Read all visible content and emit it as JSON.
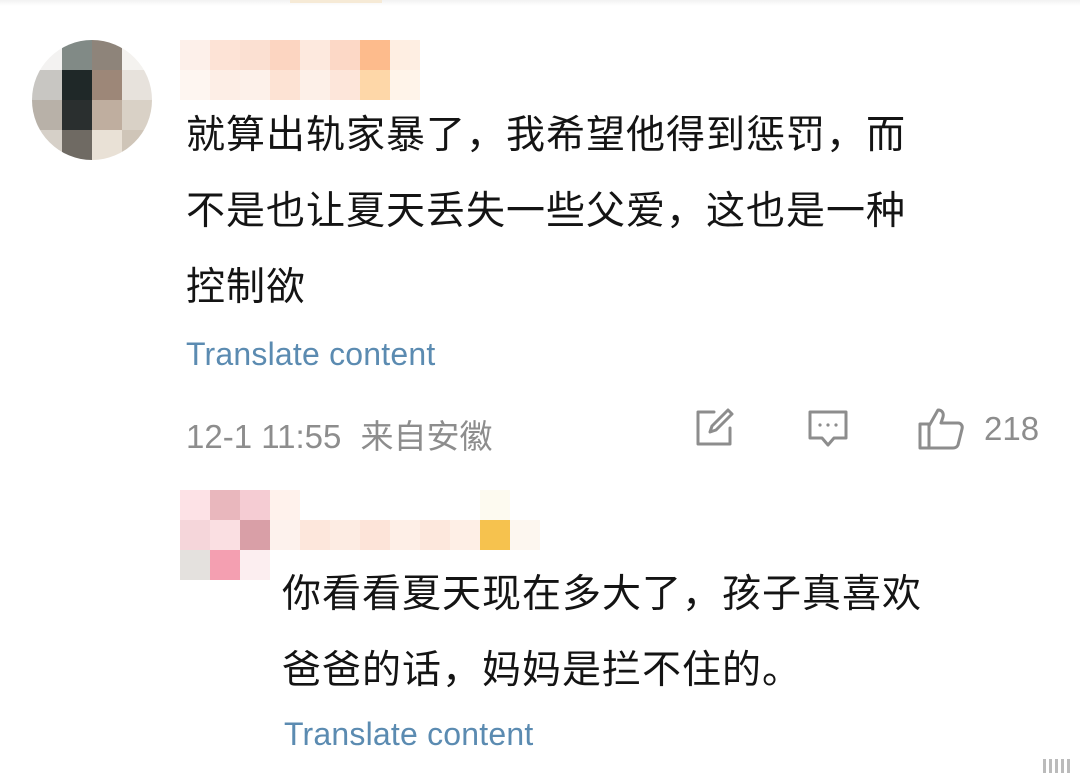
{
  "comment": {
    "text_lines": [
      "就算出轨家暴了，我希望他得到惩罚，而",
      "不是也让夏天丢失一些父爱，这也是一种",
      "控制欲"
    ],
    "translate_label": "Translate content",
    "timestamp": "12-1 11:55",
    "location": "来自安徽",
    "like_count": "218",
    "icons": {
      "edit": "edit-icon",
      "reply": "comment-icon",
      "like": "thumbs-up-icon"
    }
  },
  "reply": {
    "text_lines": [
      "你看看夏天现在多大了，孩子真喜欢",
      "爸爸的话，妈妈是拦不住的。"
    ],
    "translate_label": "Translate content"
  },
  "colors": {
    "link": "#5b8bb1",
    "meta": "#8d8d8d",
    "text": "#141414"
  }
}
